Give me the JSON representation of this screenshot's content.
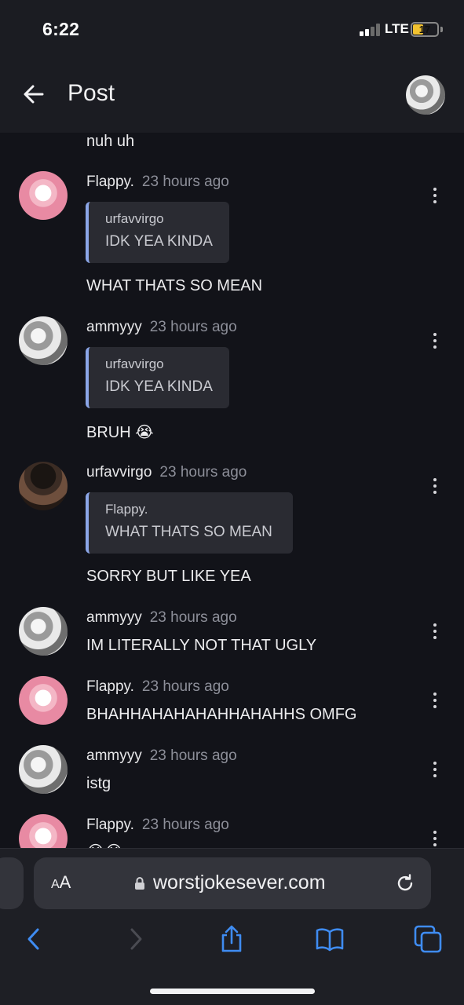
{
  "status_bar": {
    "time": "6:22",
    "network": "LTE",
    "battery": "17"
  },
  "header": {
    "title": "Post"
  },
  "comments": [
    {
      "text": "nuh uh"
    },
    {
      "user": "Flappy.",
      "time": "23 hours ago",
      "quote": {
        "user": "urfavvirgo",
        "text": "IDK YEA KINDA"
      },
      "text": "WHAT THATS SO MEAN"
    },
    {
      "user": "ammyyy",
      "time": "23 hours ago",
      "quote": {
        "user": "urfavvirgo",
        "text": "IDK YEA KINDA"
      },
      "text": "BRUH 😭"
    },
    {
      "user": "urfavvirgo",
      "time": "23 hours ago",
      "quote": {
        "user": "Flappy.",
        "text": "WHAT THATS SO MEAN"
      },
      "text": "SORRY BUT LIKE YEA"
    },
    {
      "user": "ammyyy",
      "time": "23 hours ago",
      "text": "IM LITERALLY NOT THAT UGLY"
    },
    {
      "user": "Flappy.",
      "time": "23 hours ago",
      "text": "BHAHHAHAHAHAHHAHAHHS OMFG"
    },
    {
      "user": "ammyyy",
      "time": "23 hours ago",
      "text": "istg"
    },
    {
      "user": "Flappy.",
      "time": "23 hours ago",
      "text": "😭😭"
    }
  ],
  "browser": {
    "aa_small": "A",
    "aa_large": "A",
    "url": "worstjokesever.com"
  },
  "icons": {
    "back": "back-arrow-icon",
    "more": "more-vertical-icon",
    "lock": "lock-icon",
    "reload": "reload-icon",
    "nav_back": "chevron-left-icon",
    "nav_forward": "chevron-right-icon",
    "share": "share-icon",
    "bookmarks": "book-icon",
    "tabs": "tabs-icon"
  },
  "colors": {
    "accent": "#3f8cf2",
    "quote_bar": "#8ba6e8",
    "background": "#121319"
  }
}
